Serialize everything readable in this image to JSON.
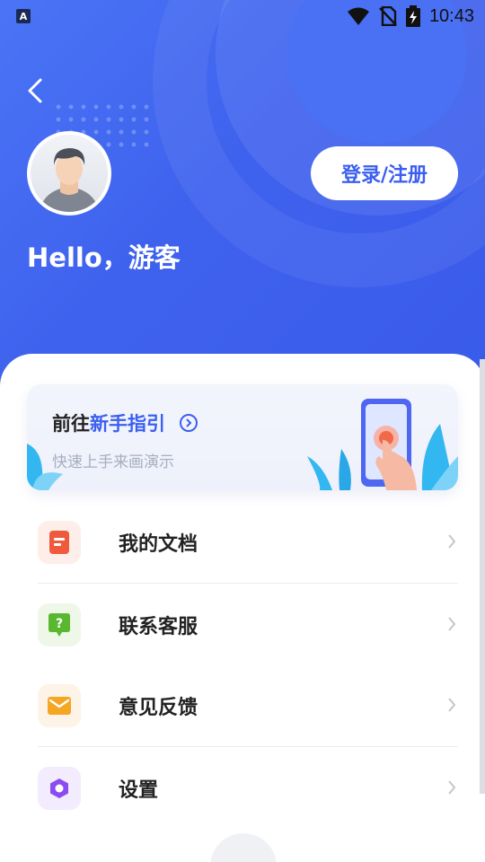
{
  "statusbar": {
    "app_icon": "A",
    "time": "10:43",
    "icons": [
      "wifi-icon",
      "no-sim-icon",
      "battery-charging-icon"
    ]
  },
  "header": {
    "back_icon": "chevron-left-icon",
    "login_label": "登录/注册",
    "greeting": "Hello，游客"
  },
  "guide": {
    "title_prefix": "前往",
    "title_highlight": "新手指引",
    "subtitle": "快速上手来画演示",
    "arrow_icon": "circle-chevron-right-icon"
  },
  "menu": {
    "items": [
      {
        "label": "我的文档",
        "icon": "document-icon",
        "color": "#f05a3c"
      },
      {
        "label": "联系客服",
        "icon": "help-chat-icon",
        "color": "#5ab830"
      },
      {
        "label": "意见反馈",
        "icon": "mail-icon",
        "color": "#f5a623"
      },
      {
        "label": "设置",
        "icon": "settings-hexagon-icon",
        "color": "#8a4bf0"
      }
    ]
  },
  "colors": {
    "accent": "#3b5ff0",
    "hero": "#4468f2"
  }
}
